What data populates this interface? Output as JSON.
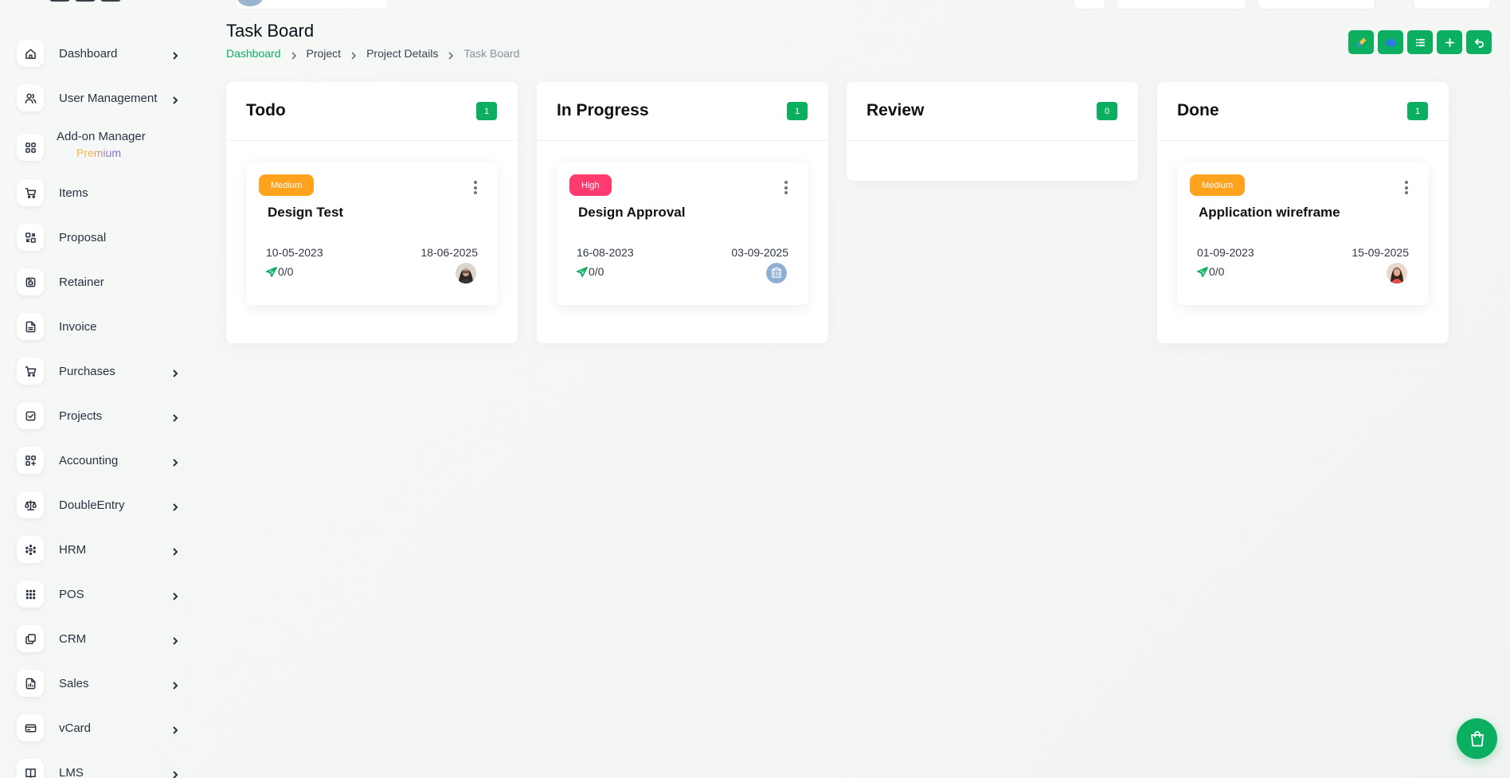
{
  "header": {
    "title": "Task Board",
    "breadcrumb": [
      "Dashboard",
      "Project",
      "Project Details",
      "Task Board"
    ]
  },
  "toolbar": {
    "buttons": [
      "pencil-icon",
      "cloud-icon",
      "list-icon",
      "plus-icon",
      "undo-icon"
    ]
  },
  "sidebar": {
    "items": [
      {
        "label": "Dashboard",
        "icon": "home-icon",
        "has_children": true
      },
      {
        "label": "User Management",
        "icon": "users-icon",
        "has_children": true
      },
      {
        "label": "Add-on Manager",
        "sublabel": "Premium",
        "icon": "apps-icon",
        "has_children": false
      },
      {
        "label": "Items",
        "icon": "cart-icon",
        "has_children": false
      },
      {
        "label": "Proposal",
        "icon": "exchange-icon",
        "has_children": false
      },
      {
        "label": "Retainer",
        "icon": "save-icon",
        "has_children": false
      },
      {
        "label": "Invoice",
        "icon": "file-icon",
        "has_children": false
      },
      {
        "label": "Purchases",
        "icon": "cart-icon",
        "has_children": true
      },
      {
        "label": "Projects",
        "icon": "checkbox-icon",
        "has_children": true
      },
      {
        "label": "Accounting",
        "icon": "grid-plus-icon",
        "has_children": true
      },
      {
        "label": "DoubleEntry",
        "icon": "scale-icon",
        "has_children": true
      },
      {
        "label": "HRM",
        "icon": "hrm-icon",
        "has_children": true
      },
      {
        "label": "POS",
        "icon": "dots-grid-icon",
        "has_children": true
      },
      {
        "label": "CRM",
        "icon": "layers-icon",
        "has_children": true
      },
      {
        "label": "Sales",
        "icon": "report-icon",
        "has_children": true
      },
      {
        "label": "vCard",
        "icon": "card-icon",
        "has_children": true
      },
      {
        "label": "LMS",
        "icon": "book-icon",
        "has_children": true
      }
    ]
  },
  "board": {
    "columns": [
      {
        "title": "Todo",
        "count": "1",
        "tasks": [
          {
            "priority": "Medium",
            "title": "Design Test",
            "start": "10-05-2023",
            "end": "18-06-2025",
            "progress": "0/0",
            "avatar": "woman-dark-hair"
          }
        ]
      },
      {
        "title": "In Progress",
        "count": "1",
        "tasks": [
          {
            "priority": "High",
            "title": "Design Approval",
            "start": "16-08-2023",
            "end": "03-09-2025",
            "progress": "0/0",
            "avatar": "building-icon"
          }
        ]
      },
      {
        "title": "Review",
        "count": "0",
        "tasks": []
      },
      {
        "title": "Done",
        "count": "1",
        "tasks": [
          {
            "priority": "Medium",
            "title": "Application wireframe",
            "start": "01-09-2023",
            "end": "15-09-2025",
            "progress": "0/0",
            "avatar": "woman-red-top"
          }
        ]
      }
    ]
  },
  "colors": {
    "accent": "#0caf60",
    "priority_medium": "#ffa21d",
    "priority_high": "#ff3a6e"
  }
}
